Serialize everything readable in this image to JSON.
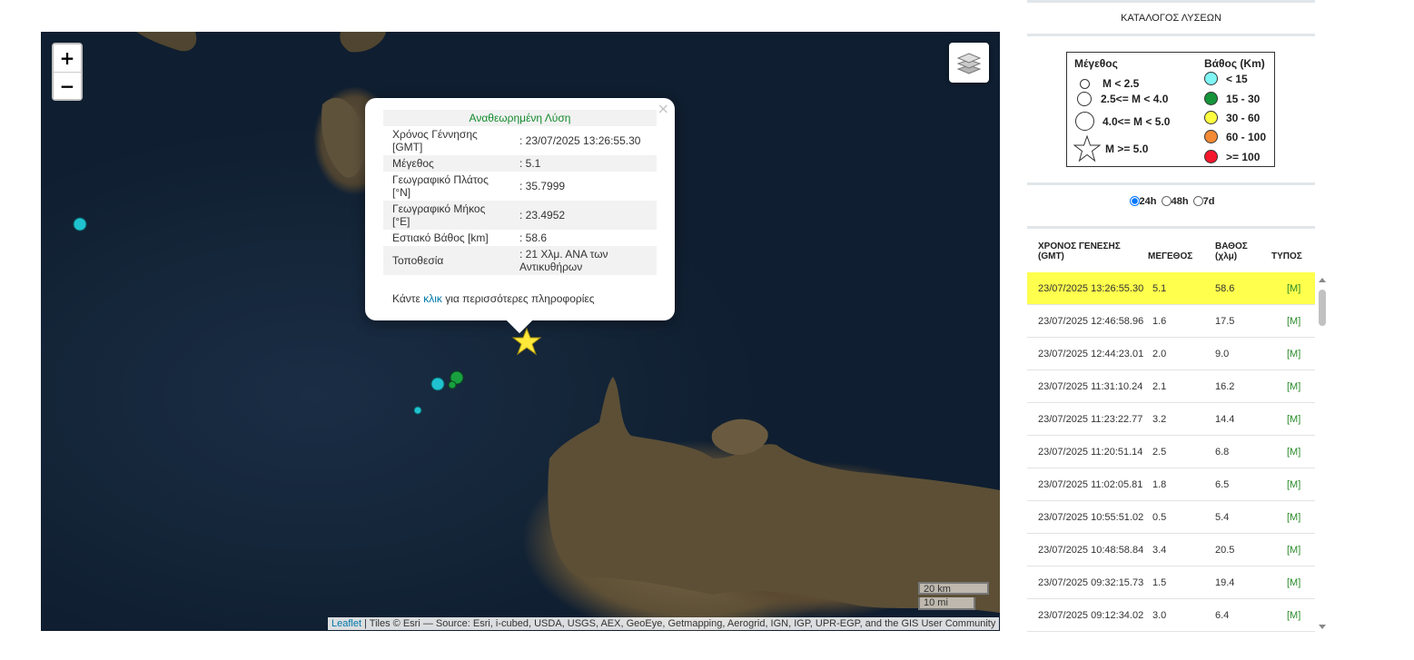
{
  "map": {
    "zoom_in": "+",
    "zoom_out": "−",
    "popup": {
      "title": "Αναθεωρημένη Λύση",
      "close": "×",
      "rows": [
        {
          "label": "Χρόνος Γέννησης [GMT]",
          "value": ": 23/07/2025 13:26:55.30"
        },
        {
          "label": "Μέγεθος",
          "value": ": 5.1"
        },
        {
          "label": "Γεωγραφικό Πλάτος [°N]",
          "value": ": 35.7999"
        },
        {
          "label": "Γεωγραφικό Μήκος [°E]",
          "value": ": 23.4952"
        },
        {
          "label": "Εστιακό Βάθος [km]",
          "value": ": 58.6"
        },
        {
          "label": "Τοποθεσία",
          "value": ": 21 Χλμ. ΑΝΑ των Αντικυθήρων"
        }
      ],
      "footer_pre": "Κάντε ",
      "footer_link": "κλικ",
      "footer_post": " για περισσότερες πληροφορίες"
    },
    "attribution_link": "Leaflet",
    "attribution_text": " | Tiles © Esri — Source: Esri, i-cubed, USDA, USGS, AEX, GeoEye, Getmapping, Aerogrid, IGN, IGP, UPR-EGP, and the GIS User Community",
    "scale_km": "20 km",
    "scale_mi": "10 mi",
    "colors": {
      "cyan": "#1fc2cf",
      "green": "#18a040",
      "yellow": "#ffe93a"
    }
  },
  "panel": {
    "title": "ΚΑΤΑΛΟΓΟΣ ΛΥΣΕΩΝ",
    "legend": {
      "mag_header": "Μέγεθος",
      "depth_header": "Βάθος (Km)",
      "mags": [
        "M < 2.5",
        "2.5<= M < 4.0",
        "4.0<= M < 5.0",
        "M >= 5.0"
      ],
      "depths": [
        {
          "label": "< 15",
          "color": "#7ff5f5"
        },
        {
          "label": "15 - 30",
          "color": "#16943a"
        },
        {
          "label": "30 - 60",
          "color": "#ffff40"
        },
        {
          "label": "60 - 100",
          "color": "#f58a35"
        },
        {
          "label": ">= 100",
          "color": "#f5172b"
        }
      ]
    },
    "radios": [
      {
        "label": "24h",
        "checked": true
      },
      {
        "label": "48h",
        "checked": false
      },
      {
        "label": "7d",
        "checked": false
      }
    ],
    "headers": {
      "time": "ΧΡΟΝΟΣ ΓΕΝΕΣΗΣ (GMT)",
      "mag": "ΜΕΓΕΘΟΣ",
      "depth": "ΒΑΘΟΣ (χλμ)",
      "type": "ΤΥΠΟΣ"
    },
    "rows": [
      {
        "time": "23/07/2025 13:26:55.30",
        "mag": "5.1",
        "depth": "58.6",
        "type": "[M]"
      },
      {
        "time": "23/07/2025 12:46:58.96",
        "mag": "1.6",
        "depth": "17.5",
        "type": "[M]"
      },
      {
        "time": "23/07/2025 12:44:23.01",
        "mag": "2.0",
        "depth": "9.0",
        "type": "[M]"
      },
      {
        "time": "23/07/2025 11:31:10.24",
        "mag": "2.1",
        "depth": "16.2",
        "type": "[M]"
      },
      {
        "time": "23/07/2025 11:23:22.77",
        "mag": "3.2",
        "depth": "14.4",
        "type": "[M]"
      },
      {
        "time": "23/07/2025 11:20:51.14",
        "mag": "2.5",
        "depth": "6.8",
        "type": "[M]"
      },
      {
        "time": "23/07/2025 11:02:05.81",
        "mag": "1.8",
        "depth": "6.5",
        "type": "[M]"
      },
      {
        "time": "23/07/2025 10:55:51.02",
        "mag": "0.5",
        "depth": "5.4",
        "type": "[M]"
      },
      {
        "time": "23/07/2025 10:48:58.84",
        "mag": "3.4",
        "depth": "20.5",
        "type": "[M]"
      },
      {
        "time": "23/07/2025 09:32:15.73",
        "mag": "1.5",
        "depth": "19.4",
        "type": "[M]"
      },
      {
        "time": "23/07/2025 09:12:34.02",
        "mag": "3.0",
        "depth": "6.4",
        "type": "[M]"
      }
    ]
  }
}
